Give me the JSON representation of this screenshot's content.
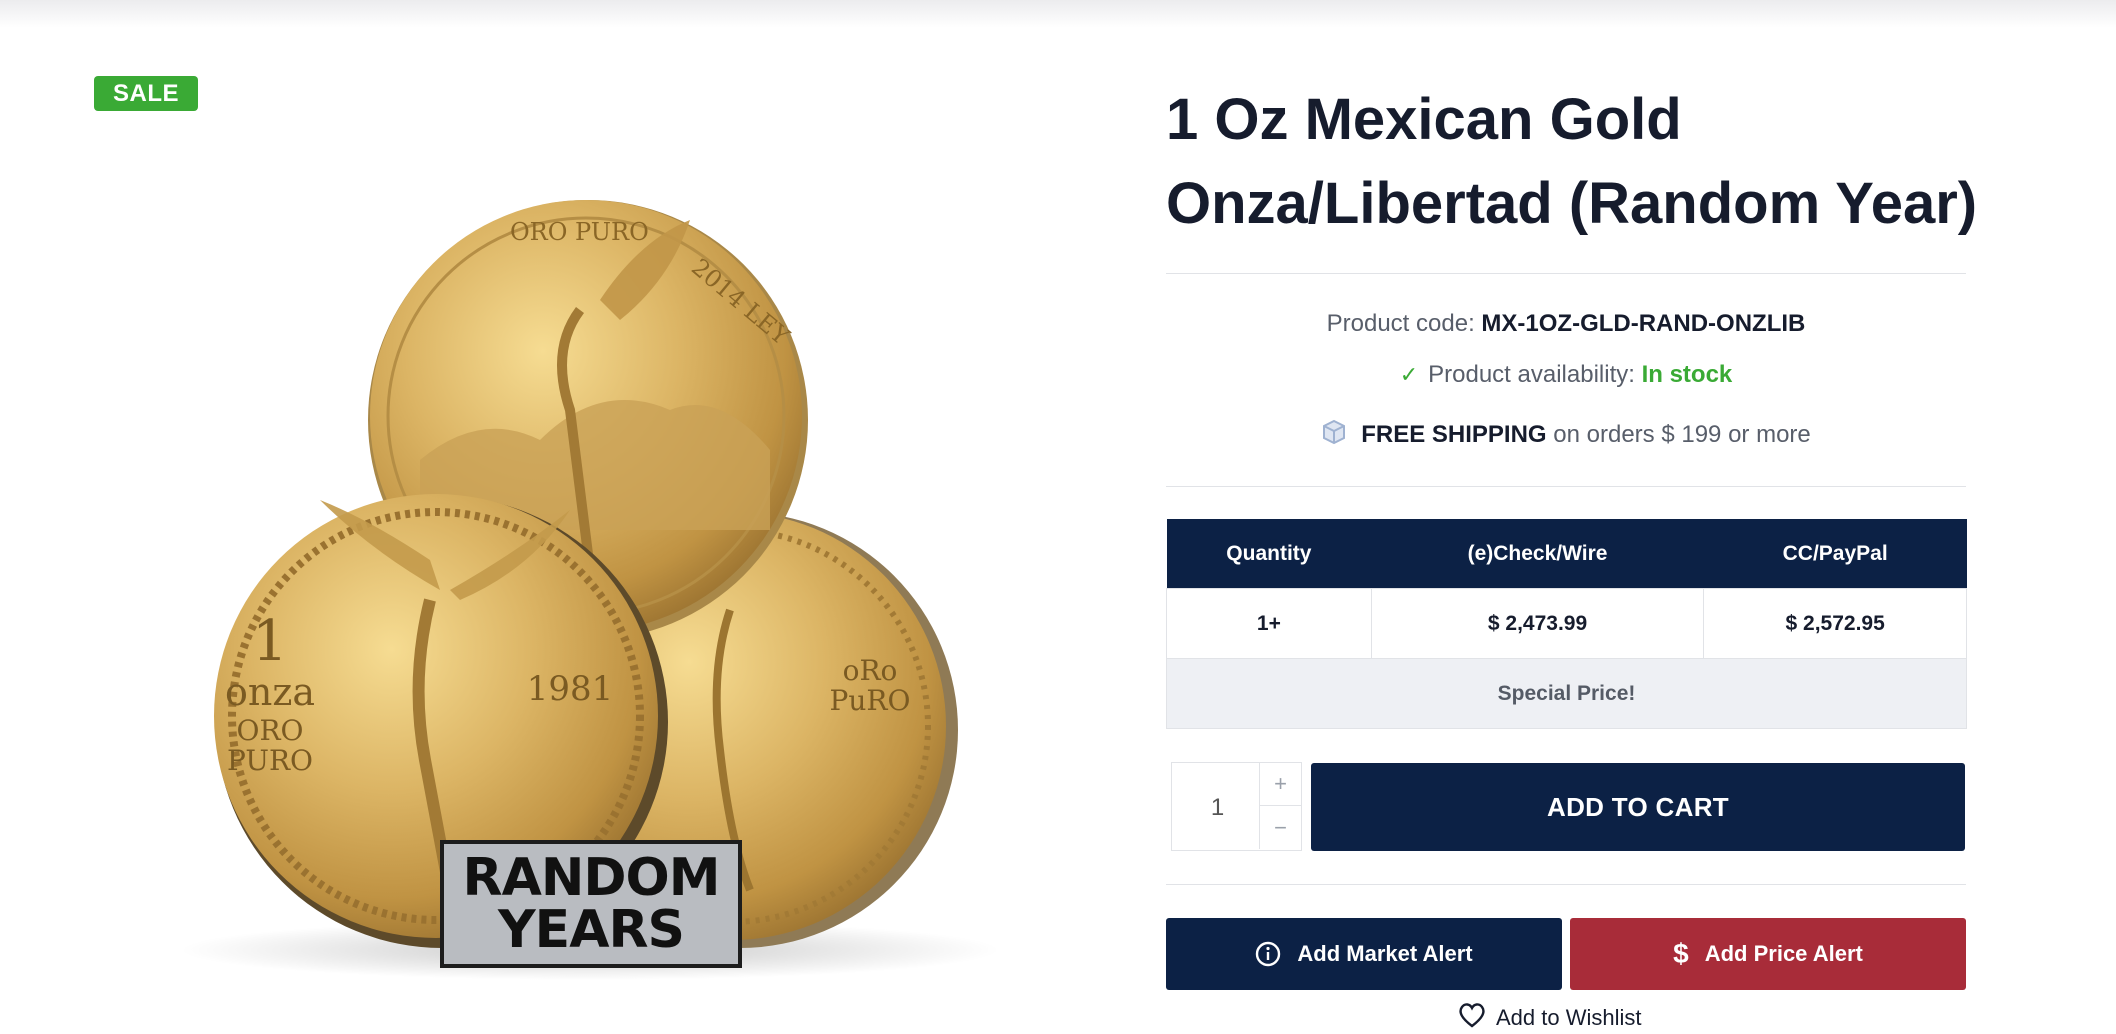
{
  "badge": {
    "label": "SALE"
  },
  "image": {
    "overlay_line1": "RANDOM",
    "overlay_line2": "YEARS"
  },
  "product": {
    "title": "1 Oz Mexican Gold Onza/Libertad (Random Year)",
    "code_label": "Product code:",
    "code_value": "MX-1OZ-GLD-RAND-ONZLIB",
    "availability_label": "Product availability:",
    "availability_value": "In stock",
    "shipping_strong": "FREE SHIPPING",
    "shipping_rest": "on orders $ 199 or more"
  },
  "pricing": {
    "headers": [
      "Quantity",
      "(e)Check/Wire",
      "CC/PayPal"
    ],
    "rows": [
      {
        "qty": "1+",
        "check": "$ 2,473.99",
        "card": "$ 2,572.95"
      }
    ],
    "special": "Special Price!"
  },
  "cart": {
    "quantity": "1",
    "plus": "+",
    "minus": "−",
    "add_label": "ADD TO CART"
  },
  "alerts": {
    "market_label": "Add Market Alert",
    "price_label": "Add Price Alert"
  },
  "wishlist": {
    "label": "Add to Wishlist"
  },
  "colors": {
    "navy": "#0c2145",
    "sale_green": "#3aaa35",
    "price_alert_red": "#a82c39",
    "gold": "#d9b25a"
  }
}
